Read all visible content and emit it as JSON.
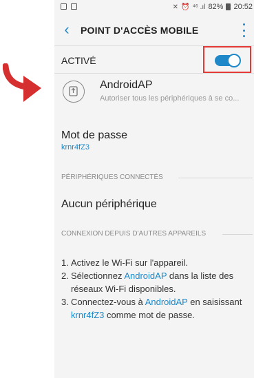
{
  "status_bar": {
    "battery": "82%",
    "time": "20:52",
    "signal_glyphs": "⁴⁶ .ıl"
  },
  "header": {
    "title": "POINT D'ACCÈS MOBILE"
  },
  "active": {
    "label": "ACTIVÉ",
    "toggle_on": true
  },
  "network": {
    "name": "AndroidAP",
    "description": "Autoriser tous les périphériques à se co..."
  },
  "password": {
    "label": "Mot de passe",
    "value": "krnr4fZ3"
  },
  "connected": {
    "heading": "PÉRIPHÉRIQUES CONNECTÉS",
    "empty_text": "Aucun périphérique"
  },
  "other_devices": {
    "heading": "CONNEXION DEPUIS D'AUTRES APPAREILS"
  },
  "instructions": {
    "step1_num": "1.",
    "step1_text": "Activez le Wi-Fi sur l'appareil.",
    "step2_num": "2.",
    "step2_a": "Sélectionnez ",
    "step2_link": "AndroidAP",
    "step2_b": " dans la liste des réseaux Wi-Fi disponibles.",
    "step3_num": "3.",
    "step3_a": "Connectez-vous à ",
    "step3_link1": "AndroidAP",
    "step3_b": " en saisissant ",
    "step3_link2": "krnr4fZ3",
    "step3_c": " comme mot de passe."
  },
  "colors": {
    "accent": "#1e88c9",
    "highlight": "#e53935"
  }
}
